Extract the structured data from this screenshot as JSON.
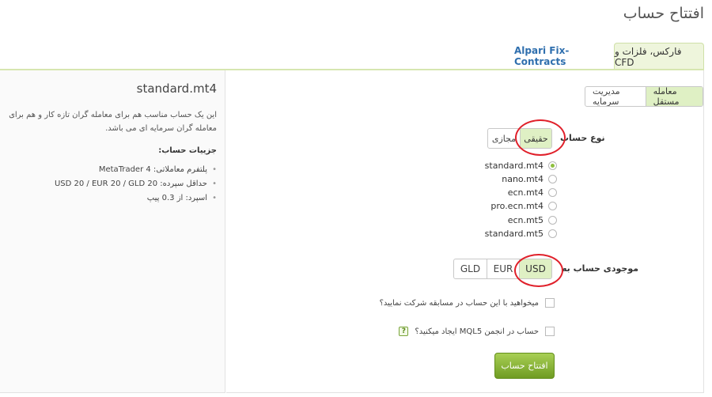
{
  "page": {
    "title": "افتتاح حساب"
  },
  "tabs": [
    {
      "label": "فارکس، فلزات و CFD",
      "active": true
    },
    {
      "label": "Alpari Fix-Contracts",
      "active": false
    }
  ],
  "mode_toggle": {
    "options": [
      "معامله مستقل",
      "مدیریت سرمایه"
    ],
    "selected": "معامله مستقل"
  },
  "account_type": {
    "label": "نوع حساب",
    "options": [
      "حقیقی",
      "مجازی"
    ],
    "selected": "حقیقی"
  },
  "accounts": [
    {
      "name": "standard.mt4",
      "selected": true
    },
    {
      "name": "nano.mt4",
      "selected": false
    },
    {
      "name": "ecn.mt4",
      "selected": false
    },
    {
      "name": "pro.ecn.mt4",
      "selected": false
    },
    {
      "name": "ecn.mt5",
      "selected": false
    },
    {
      "name": "standard.mt5",
      "selected": false
    }
  ],
  "currency": {
    "label": "موجودی حساب به",
    "options": [
      "USD",
      "EUR",
      "GLD"
    ],
    "selected": "USD"
  },
  "contest_checkbox": {
    "label": "میخواهید با این حساب در مسابقه شرکت نمایید؟",
    "checked": false
  },
  "mql5_checkbox": {
    "label": "حساب در انجمن MQL5 ایجاد میکنید؟",
    "checked": false,
    "help": "?"
  },
  "submit": {
    "label": "افتتاح حساب"
  },
  "info_panel": {
    "title": "standard.mt4",
    "description": "این یک حساب مناسب هم برای معامله گران تازه کار و هم برای معامله گران سرمایه ای می باشد.",
    "details_heading": "جزییات حساب:",
    "details": [
      "پلتفرم معاملاتی: MetaTrader 4",
      "حداقل سپرده: USD 20 / EUR 20 / GLD 20",
      "اسپرد: از 0.3 پیپ"
    ]
  },
  "colors": {
    "accent_green": "#dff0c4",
    "button_green": "#7aa53a",
    "link_blue": "#2f6fae",
    "annotation_red": "#e0202a"
  }
}
